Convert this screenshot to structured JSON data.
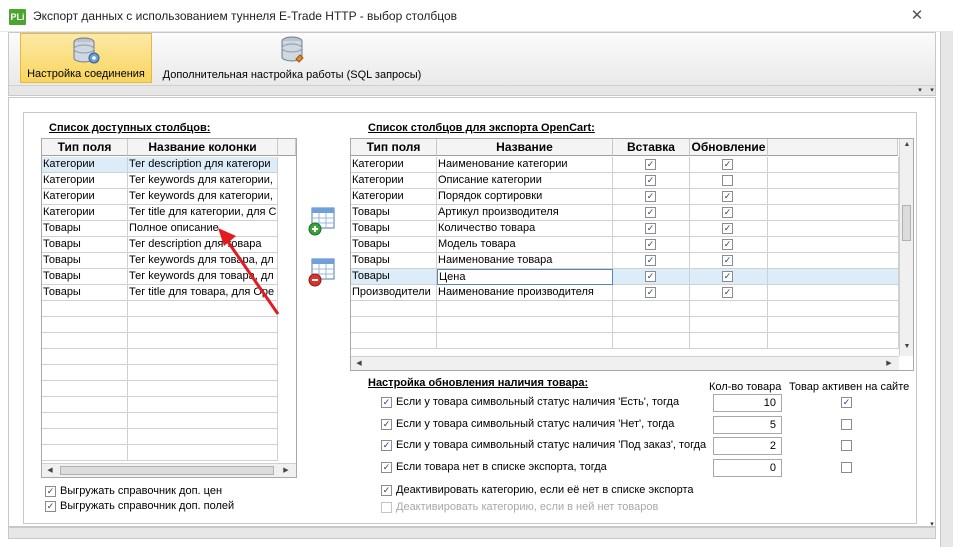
{
  "window": {
    "app_icon_text": "PLi",
    "title": "Экспорт данных с использованием туннеля E-Trade HTTP - выбор столбцов",
    "close_glyph": "✕"
  },
  "ribbon": {
    "tabs": [
      {
        "label": "Настройка соединения",
        "icon": "database-gear-icon",
        "active": true
      },
      {
        "label": "Дополнительная настройка работы (SQL запросы)",
        "icon": "database-icon",
        "active": false
      }
    ]
  },
  "available": {
    "title": "Список доступных столбцов:",
    "headers": [
      "Тип поля",
      "Название колонки"
    ],
    "rows": [
      [
        "Категории",
        "Тег description для категори"
      ],
      [
        "Категории",
        "Тег keywords для категории,"
      ],
      [
        "Категории",
        "Тег keywords для категории,"
      ],
      [
        "Категории",
        "Тег title для категории, для С"
      ],
      [
        "Товары",
        "Полное описание"
      ],
      [
        "Товары",
        "Тег description для товара"
      ],
      [
        "Товары",
        "Тег keywords для товара, дл"
      ],
      [
        "Товары",
        "Тег keywords для товара, дл"
      ],
      [
        "Товары",
        "Тег title для товара, для Ope"
      ]
    ],
    "selected_row": 0
  },
  "export": {
    "title": "Список столбцов для экспорта OpenCart:",
    "headers": [
      "Тип поля",
      "Название",
      "Вставка",
      "Обновление"
    ],
    "rows": [
      {
        "type": "Категории",
        "name": "Наименование категории",
        "insert": true,
        "update": true
      },
      {
        "type": "Категории",
        "name": "Описание категории",
        "insert": true,
        "update": false
      },
      {
        "type": "Категории",
        "name": "Порядок сортировки",
        "insert": true,
        "update": true
      },
      {
        "type": "Товары",
        "name": "Артикул производителя",
        "insert": true,
        "update": true
      },
      {
        "type": "Товары",
        "name": "Количество товара",
        "insert": true,
        "update": true
      },
      {
        "type": "Товары",
        "name": "Модель товара",
        "insert": true,
        "update": true
      },
      {
        "type": "Товары",
        "name": "Наименование товара",
        "insert": true,
        "update": true
      },
      {
        "type": "Товары",
        "name": "Цена",
        "insert": true,
        "update": true
      },
      {
        "type": "Производители",
        "name": "Наименование производителя",
        "insert": true,
        "update": true
      }
    ],
    "selected_row": 7
  },
  "availability": {
    "title": "Настройка обновления наличия товара:",
    "col_qty": "Кол-во товара",
    "col_active": "Товар активен на сайте",
    "options": [
      {
        "label": "Если у товара символьный статус наличия 'Есть', тогда",
        "checked": true,
        "qty": "10",
        "active": true
      },
      {
        "label": "Если у товара символьный статус наличия 'Нет', тогда",
        "checked": true,
        "qty": "5",
        "active": false
      },
      {
        "label": "Если у товара символьный статус наличия 'Под заказ', тогда",
        "checked": true,
        "qty": "2",
        "active": false
      },
      {
        "label": "Если товара нет в списке экспорта, тогда",
        "checked": true,
        "qty": "0",
        "active": false
      }
    ],
    "deactivate_missing": "Деактивировать категорию, если её нет в списке экспорта",
    "deactivate_empty": "Деактивировать категорию, если в ней нет товаров"
  },
  "bottom_options": [
    {
      "label": "Выгружать справочник доп. цен",
      "checked": true
    },
    {
      "label": "Выгружать справочник доп. полей",
      "checked": true
    }
  ],
  "colors": {
    "selection": "#dcecf9",
    "active_tab": "#f8d55e",
    "arrow": "#e11b22"
  }
}
